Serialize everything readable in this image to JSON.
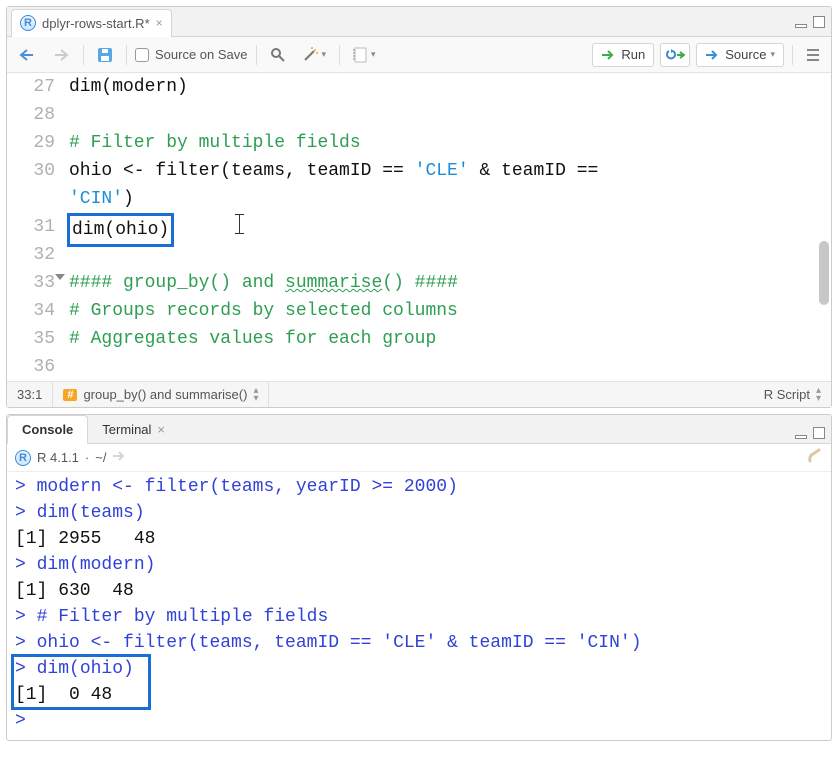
{
  "editor": {
    "tab": {
      "filename": "dplyr-rows-start.R*"
    },
    "toolbar": {
      "source_on_save": "Source on Save",
      "run": "Run",
      "source": "Source"
    },
    "lines": [
      {
        "n": 27,
        "tokens": [
          {
            "t": "dim(modern)",
            "c": ""
          }
        ]
      },
      {
        "n": 28,
        "tokens": []
      },
      {
        "n": 29,
        "tokens": [
          {
            "t": "# Filter by multiple fields",
            "c": "comment"
          }
        ]
      },
      {
        "n": 30,
        "tokens": [
          {
            "t": "ohio <- filter(teams, teamID == ",
            "c": ""
          },
          {
            "t": "'CLE'",
            "c": "string"
          },
          {
            "t": " & teamID == ",
            "c": ""
          }
        ]
      },
      {
        "n": "",
        "tokens": [
          {
            "t": "'CIN'",
            "c": "string"
          },
          {
            "t": ")",
            "c": ""
          }
        ]
      },
      {
        "n": 31,
        "tokens": [
          {
            "t": "dim(ohio)",
            "c": "",
            "hl": true
          }
        ],
        "caret_after": true
      },
      {
        "n": 32,
        "tokens": []
      },
      {
        "n": 33,
        "fold": true,
        "tokens": [
          {
            "t": "#### group_by() and ",
            "c": "comment"
          },
          {
            "t": "summarise",
            "c": "comment squiggle"
          },
          {
            "t": "() ####",
            "c": "comment"
          }
        ]
      },
      {
        "n": 34,
        "tokens": [
          {
            "t": "# Groups records by selected columns",
            "c": "comment"
          }
        ]
      },
      {
        "n": 35,
        "tokens": [
          {
            "t": "# Aggregates values for each group",
            "c": "comment"
          }
        ]
      },
      {
        "n": 36,
        "tokens": []
      }
    ],
    "status": {
      "pos": "33:1",
      "section": "group_by() and summarise()",
      "lang": "R Script"
    }
  },
  "console": {
    "tabs": {
      "console": "Console",
      "terminal": "Terminal"
    },
    "version": "R 4.1.1",
    "cwd": "~/",
    "lines": [
      {
        "type": "in",
        "text": "modern <- filter(teams, yearID >= 2000)"
      },
      {
        "type": "in",
        "text": "dim(teams)"
      },
      {
        "type": "out",
        "text": "[1] 2955   48"
      },
      {
        "type": "in",
        "text": "dim(modern)"
      },
      {
        "type": "out",
        "text": "[1] 630  48"
      },
      {
        "type": "in",
        "text": "# Filter by multiple fields"
      },
      {
        "type": "in",
        "text": "ohio <- filter(teams, teamID == 'CLE' & teamID == 'CIN')"
      },
      {
        "type": "in",
        "text": "dim(ohio)",
        "hl": true
      },
      {
        "type": "out",
        "text": "[1]  0 48",
        "hl": true
      },
      {
        "type": "in",
        "text": ""
      }
    ]
  }
}
